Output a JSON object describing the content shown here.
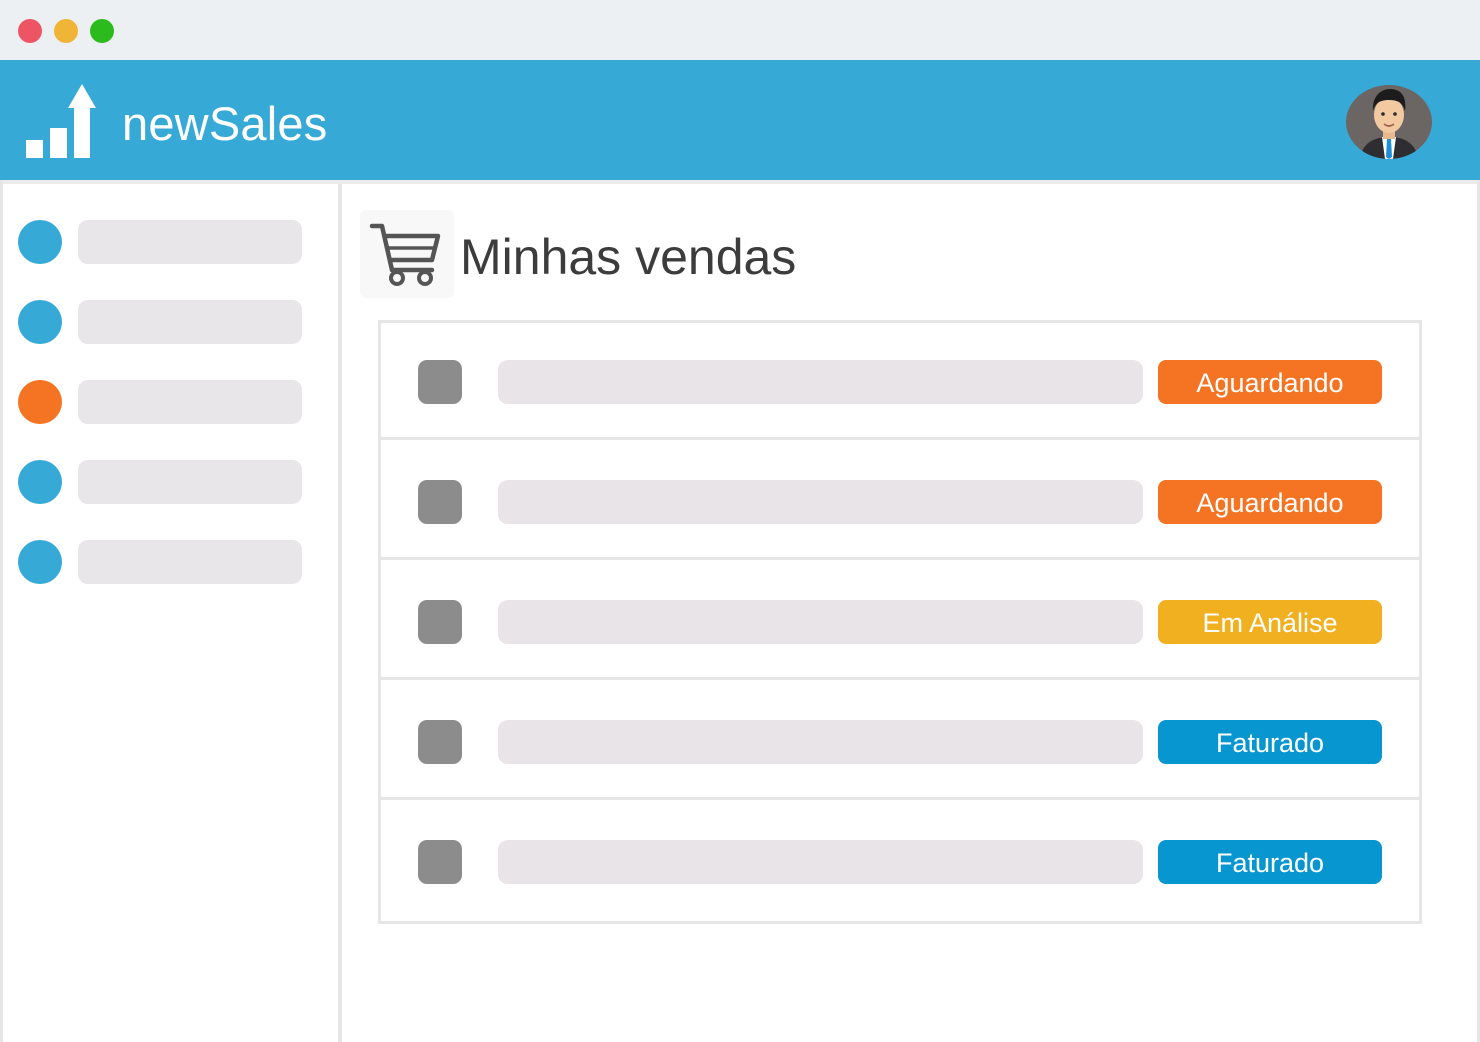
{
  "colors": {
    "titlebar_dot_close": "#ed5565",
    "titlebar_dot_minimize": "#f0b536",
    "titlebar_dot_maximize": "#2bbb1c",
    "header_bg": "#37a9d6",
    "accent_blue": "#37a9d6",
    "accent_orange": "#f47424"
  },
  "header": {
    "brand": "newSales",
    "logo_icon": "bar-chart-up-arrow-icon",
    "avatar_icon": "businessman-avatar"
  },
  "sidebar": {
    "items": [
      {
        "color": "#37a9d6",
        "active": false
      },
      {
        "color": "#37a9d6",
        "active": false
      },
      {
        "color": "#f47424",
        "active": true
      },
      {
        "color": "#37a9d6",
        "active": false
      },
      {
        "color": "#37a9d6",
        "active": false
      }
    ]
  },
  "main": {
    "icon": "shopping-cart-icon",
    "title": "Minhas vendas",
    "sales": [
      {
        "status": "Aguardando",
        "status_color": "#f47424"
      },
      {
        "status": "Aguardando",
        "status_color": "#f47424"
      },
      {
        "status": "Em Análise",
        "status_color": "#f0b020"
      },
      {
        "status": "Faturado",
        "status_color": "#0896d0"
      },
      {
        "status": "Faturado",
        "status_color": "#0896d0"
      }
    ]
  }
}
